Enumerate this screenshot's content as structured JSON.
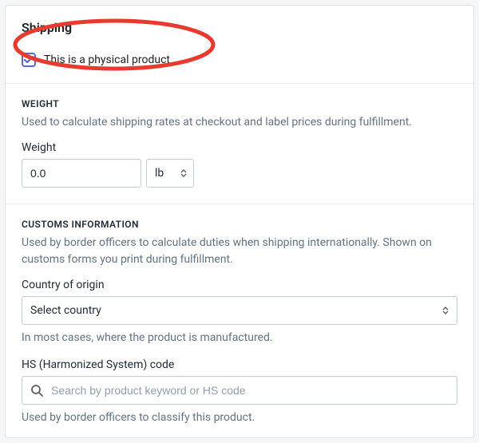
{
  "shipping": {
    "title": "Shipping",
    "physical_product_label": "This is a physical product",
    "physical_product_checked": true
  },
  "weight": {
    "header": "WEIGHT",
    "description": "Used to calculate shipping rates at checkout and label prices during fulfillment.",
    "label": "Weight",
    "value": "0.0",
    "unit": "lb"
  },
  "customs": {
    "header": "CUSTOMS INFORMATION",
    "description": "Used by border officers to calculate duties when shipping internationally. Shown on customs forms you print during fulfillment.",
    "country_label": "Country of origin",
    "country_selected": "Select country",
    "country_help": "In most cases, where the product is manufactured.",
    "hs_label": "HS (Harmonized System) code",
    "hs_placeholder": "Search by product keyword or HS code",
    "hs_help": "Used by border officers to classify this product."
  }
}
